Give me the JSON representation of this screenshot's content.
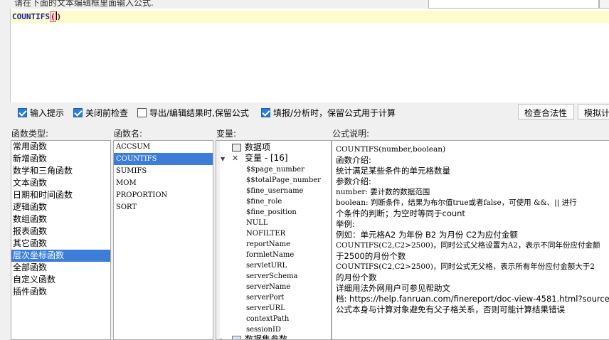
{
  "hint": {
    "text": "请在下面的文本编辑框里面输入公式."
  },
  "editor": {
    "fn": "COUNTIFS",
    "open": "(",
    "close": ")"
  },
  "options": {
    "input_hint": {
      "label": "输入提示",
      "checked": true
    },
    "check_on_close": {
      "label": "关闭前检查",
      "checked": true
    },
    "export_keep": {
      "label": "导出/编辑结果时,保留公式",
      "checked": false
    },
    "fill_keep": {
      "label": "填报/分析时，保留公式用于计算",
      "checked": true
    }
  },
  "buttons": {
    "check_validity": "检查合法性",
    "simulate": "模拟计"
  },
  "labels": {
    "category": "函数类型:",
    "fn_name": "函数名:",
    "variable": "变量:",
    "description": "公式说明:"
  },
  "categories": [
    "常用函数",
    "新增函数",
    "数学和三角函数",
    "文本函数",
    "日期和时间函数",
    "逻辑函数",
    "数组函数",
    "报表函数",
    "其它函数",
    "层次坐标函数",
    "全部函数",
    "自定义函数",
    "插件函数"
  ],
  "selected_category": 9,
  "functions": [
    "ACCSUM",
    "COUNTIFS",
    "SUMIFS",
    "MOM",
    "PROPORTION",
    "SORT"
  ],
  "selected_function": 1,
  "variables": {
    "data_item": "数据项",
    "var_group": "变量 - [16]",
    "items": [
      "$$page_number",
      "$$totalPage_number",
      "$fine_username",
      "$fine_role",
      "$fine_position",
      "NULL",
      "NOFILTER",
      "reportName",
      "formletName",
      "servletURL",
      "serverSchema",
      "serverName",
      "serverPort",
      "serverURL",
      "contextPath",
      "sessionID"
    ],
    "params_group": "数据集参数"
  },
  "description": [
    "COUNTIFS(number,boolean)",
    " 函数介绍:",
    "统计满足某些条件的单元格数量",
    "参数介绍:",
    " number: 要计数的数据范围",
    " boolean: 判断条件，结果为布尔值true或者false，可使用 &&、|| 进行",
    "个条件的判断；为空时等同于count",
    "举例:",
    "例如：单元格A2 为年份 B2 为月份  C2为应付金额",
    " COUNTIFS(C2,C2>2500)，同时公式父格设置为A2，表示不同年份应付金额",
    "于2500的月份个数",
    " COUNTIFS(C2,C2>2500)，同时公式无父格，表示所有年份应付金额大于2",
    "的月份个数",
    "详细用法外网用户可参见帮助文",
    "档: https://help.fanruan.com/finereport/doc-view-4581.html?source",
    "公式本身与计算对象避免有父子格关系，否则可能计算结果错误"
  ]
}
